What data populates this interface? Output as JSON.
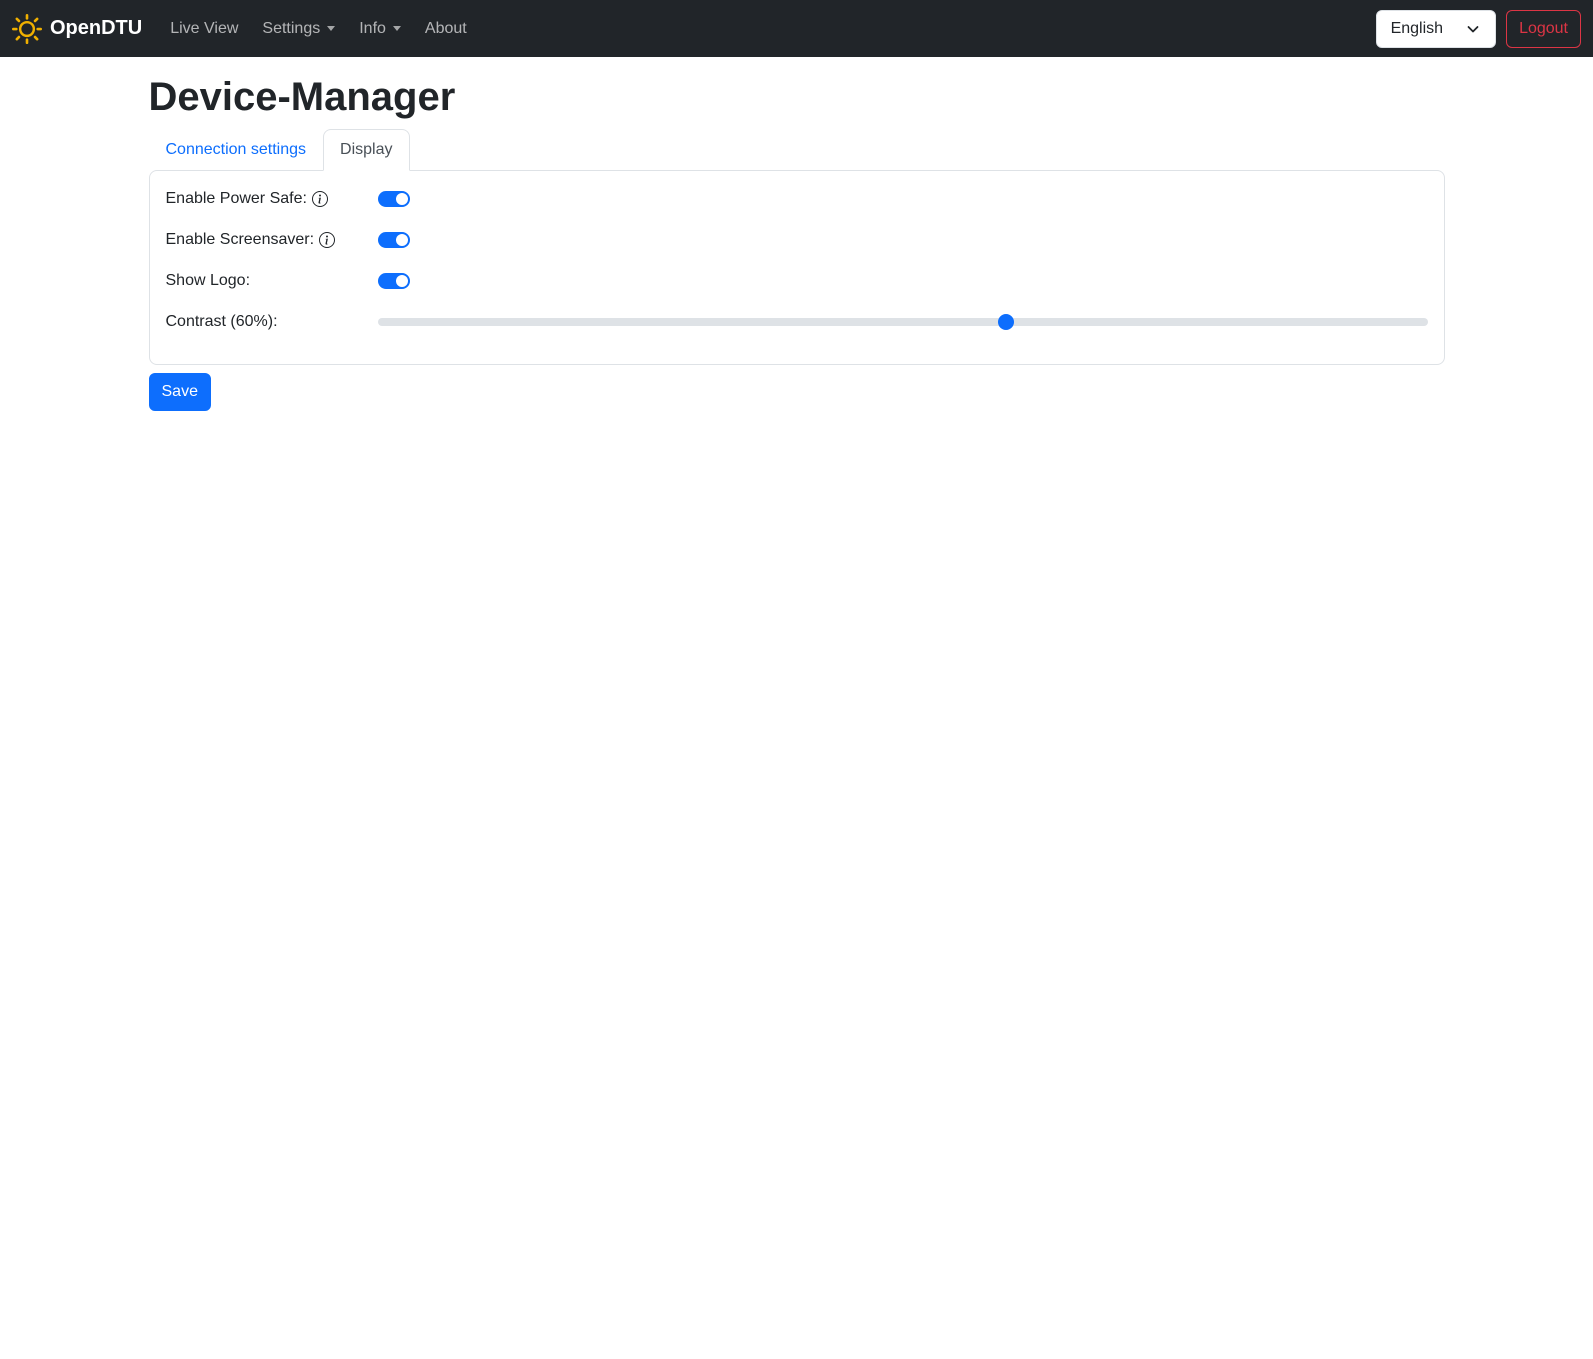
{
  "navbar": {
    "brand": "OpenDTU",
    "items": [
      {
        "label": "Live View",
        "dropdown": false
      },
      {
        "label": "Settings",
        "dropdown": true
      },
      {
        "label": "Info",
        "dropdown": true
      },
      {
        "label": "About",
        "dropdown": false
      }
    ],
    "language_selected": "English",
    "logout_label": "Logout"
  },
  "page": {
    "title": "Device-Manager",
    "tabs": [
      {
        "label": "Connection settings",
        "active": false
      },
      {
        "label": "Display",
        "active": true
      }
    ]
  },
  "form": {
    "rows": [
      {
        "label": "Enable Power Safe:",
        "type": "switch",
        "value": true,
        "info_icon": true
      },
      {
        "label": "Enable Screensaver:",
        "type": "switch",
        "value": true,
        "info_icon": true
      },
      {
        "label": "Show Logo:",
        "type": "switch",
        "value": true,
        "info_icon": false
      },
      {
        "label": "Contrast (60%):",
        "type": "range",
        "value": 60,
        "min": 0,
        "max": 100
      }
    ],
    "save_label": "Save"
  },
  "icons": {
    "sun-icon": "sun with rays (brand logo)",
    "caret-down-icon": "filled triangle dropdown indicator",
    "chevron-down-icon": "select expand chevron",
    "info-circle-icon": "circled letter i tooltip marker"
  },
  "colors": {
    "navbar_bg": "#212529",
    "accent": "#0d6efd",
    "danger": "#dc3545",
    "logo": "#f0b000",
    "border": "#dee2e6",
    "active_tab_text": "#495057"
  }
}
